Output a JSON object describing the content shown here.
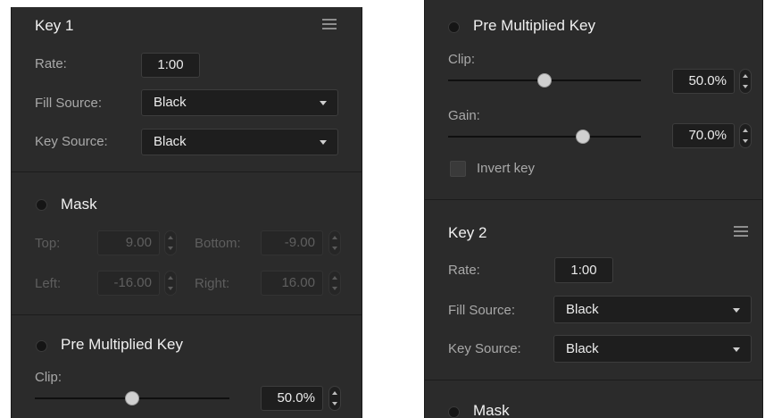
{
  "left_panel": {
    "key_title": "Key 1",
    "rate_label": "Rate:",
    "rate_value": "1:00",
    "fill_source_label": "Fill Source:",
    "fill_source_value": "Black",
    "key_source_label": "Key Source:",
    "key_source_value": "Black",
    "mask_label": "Mask",
    "top_label": "Top:",
    "top_value": "9.00",
    "bottom_label": "Bottom:",
    "bottom_value": "-9.00",
    "left_label": "Left:",
    "left_value": "-16.00",
    "right_label": "Right:",
    "right_value": "16.00",
    "premult_label": "Pre Multiplied Key",
    "clip_label": "Clip:",
    "clip_value": "50.0%",
    "clip_level": 0.5
  },
  "right_panel": {
    "premult_label": "Pre Multiplied Key",
    "clip_label": "Clip:",
    "clip_value": "50.0%",
    "clip_level": 0.5,
    "gain_label": "Gain:",
    "gain_value": "70.0%",
    "gain_level": 0.7,
    "invert_label": "Invert key",
    "invert_checked": false,
    "key_title": "Key 2",
    "rate_label": "Rate:",
    "rate_value": "1:00",
    "fill_source_label": "Fill Source:",
    "fill_source_value": "Black",
    "key_source_label": "Key Source:",
    "key_source_value": "Black",
    "mask_label": "Mask"
  }
}
